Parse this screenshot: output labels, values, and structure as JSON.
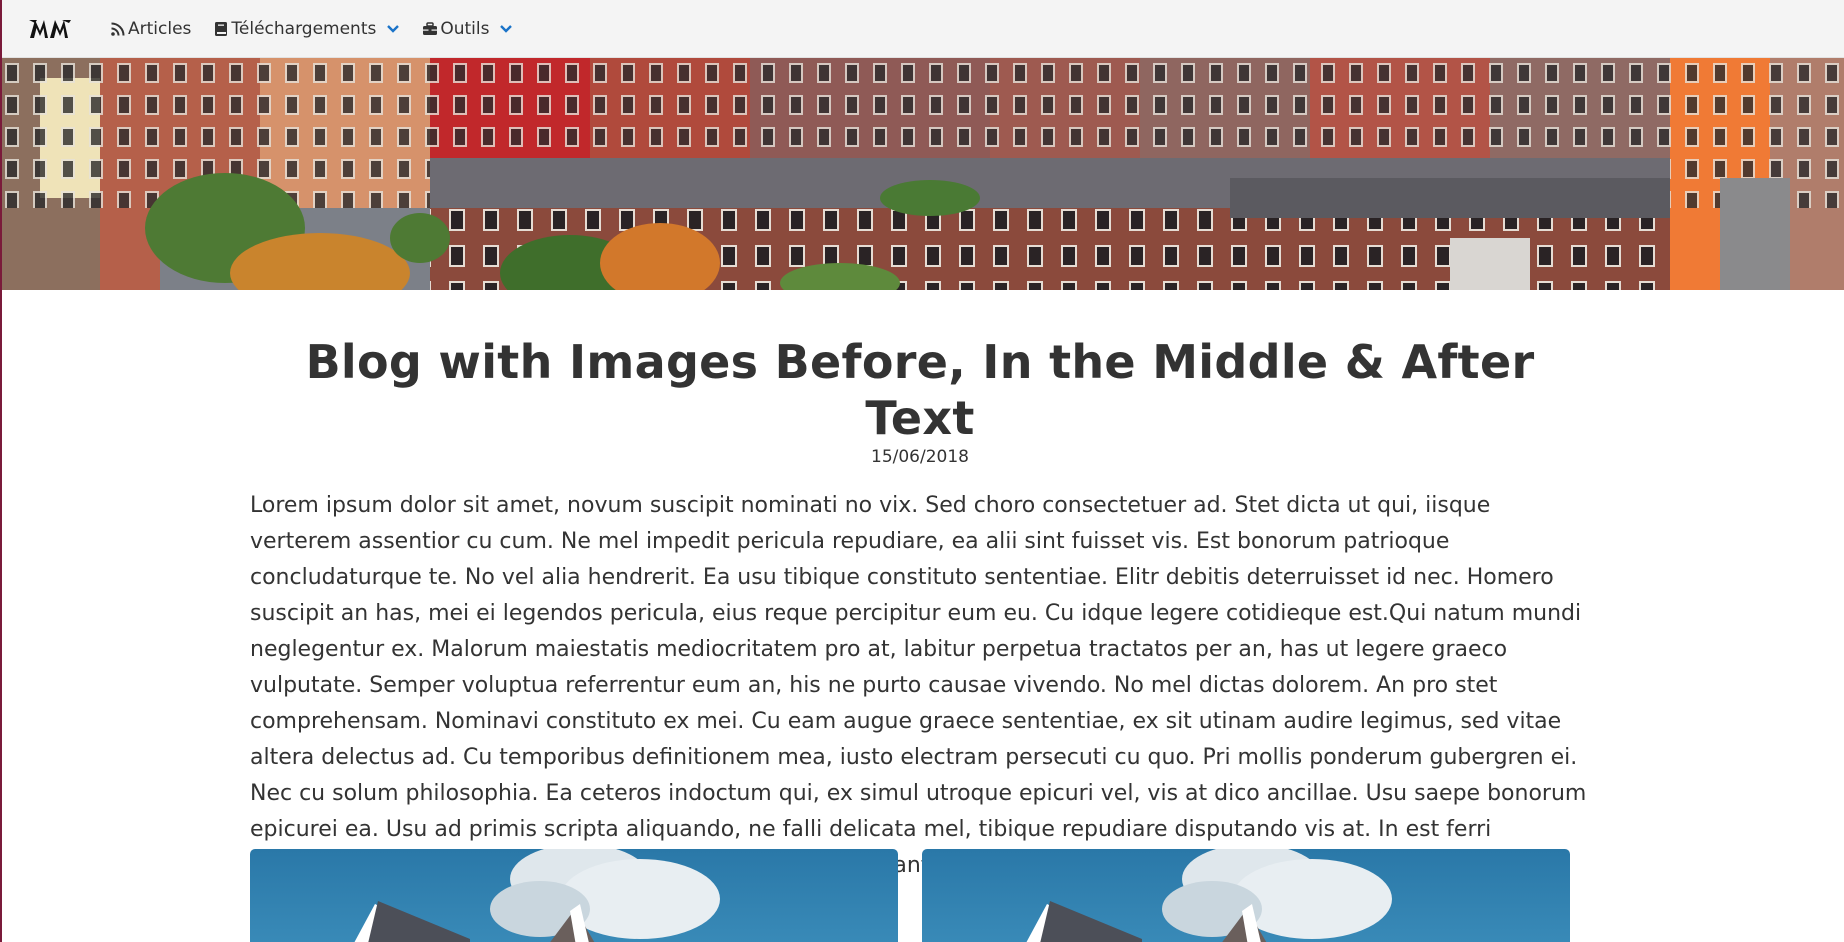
{
  "navbar": {
    "brand_icon": "mm-logo-icon",
    "items": [
      {
        "label": "Articles",
        "icon": "rss-icon",
        "has_dropdown": false
      },
      {
        "label": "Téléchargements",
        "icon": "book-icon",
        "has_dropdown": true
      },
      {
        "label": "Outils",
        "icon": "toolbox-icon",
        "has_dropdown": true
      }
    ],
    "accent_color": "#1a73c8"
  },
  "banner": {
    "image": "city-rowhouses-banner"
  },
  "article": {
    "title": "Blog with Images Before, In the Middle & After Text",
    "date": "15/06/2018",
    "body": "Lorem ipsum dolor sit amet, novum suscipit nominati no vix. Sed choro consectetuer ad. Stet dicta ut qui, iisque verterem assentior cu cum. Ne mel impedit pericula repudiare, ea alii sint fuisset vis. Est bonorum patrioque concludaturque te. No vel alia hendrerit. Ea usu tibique constituto sententiae. Elitr debitis deterruisset id nec. Homero suscipit an has, mei ei legendos pericula, eius reque percipitur eum eu. Cu idque legere cotidieque est.Qui natum mundi neglegentur ex. Malorum maiestatis mediocritatem pro at, labitur perpetua tractatos per an, has ut legere graeco vulputate. Semper voluptua referrentur eum an, his ne purto causae vivendo. No mel dictas dolorem. An pro stet comprehensam. Nominavi constituto ex mei. Cu eam augue graece sententiae, ex sit utinam audire legimus, sed vitae altera delectus ad. Cu temporibus definitionem mea, iusto electram persecuti cu quo. Pri mollis ponderum gubergren ei. Nec cu solum philosophia. Ea ceteros indoctum qui, ex simul utroque epicuri vel, vis at dico ancillae. Usu saepe bonorum epicurei ea. Usu ad primis scripta aliquando, ne falli delicata mel, tibique repudiare disputando vis at. In est ferri phaedrum sensibus, vel cu dolor legere repudiare. Sed ex antiopam patrioque.",
    "images": [
      "house-roof-photo",
      "house-roof-photo"
    ]
  }
}
